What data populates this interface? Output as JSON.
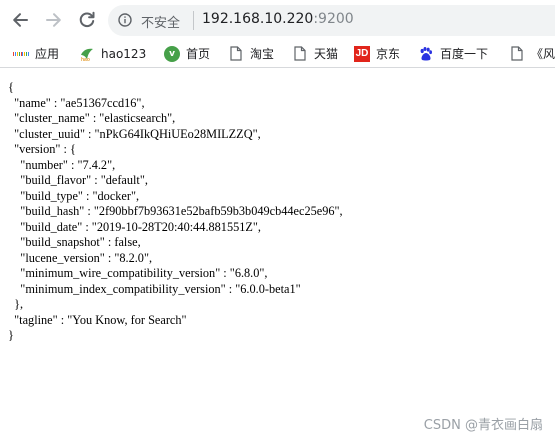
{
  "browser": {
    "security_label": "不安全",
    "url_host": "192.168.10.220",
    "url_port": ":9200"
  },
  "bookmarks": [
    {
      "label": "应用",
      "icon": "apps-grid-icon"
    },
    {
      "label": "hao123",
      "icon": "hao123-icon"
    },
    {
      "label": "首页",
      "icon": "home-icon"
    },
    {
      "label": "淘宝",
      "icon": "page-icon"
    },
    {
      "label": "天猫",
      "icon": "page-icon"
    },
    {
      "label": "京东",
      "icon": "jd-icon",
      "icon_text": "JD"
    },
    {
      "label": "百度一下",
      "icon": "baidu-paw-icon"
    },
    {
      "label": "《风",
      "icon": "page-icon"
    }
  ],
  "json_lines": [
    "{",
    "  \"name\" : \"ae51367ccd16\",",
    "  \"cluster_name\" : \"elasticsearch\",",
    "  \"cluster_uuid\" : \"nPkG64IkQHiUEo28MILZZQ\",",
    "  \"version\" : {",
    "    \"number\" : \"7.4.2\",",
    "    \"build_flavor\" : \"default\",",
    "    \"build_type\" : \"docker\",",
    "    \"build_hash\" : \"2f90bbf7b93631e52bafb59b3b049cb44ec25e96\",",
    "    \"build_date\" : \"2019-10-28T20:40:44.881551Z\",",
    "    \"build_snapshot\" : false,",
    "    \"lucene_version\" : \"8.2.0\",",
    "    \"minimum_wire_compatibility_version\" : \"6.8.0\",",
    "    \"minimum_index_compatibility_version\" : \"6.0.0-beta1\"",
    "  },",
    "  \"tagline\" : \"You Know, for Search\"",
    "}"
  ],
  "watermark": "CSDN @青衣画白扇",
  "colors": {
    "omnibox_bg": "#f1f3f4",
    "jd_red": "#e1251b",
    "hao123_green": "#46a049",
    "baidu_blue": "#2932e1"
  }
}
